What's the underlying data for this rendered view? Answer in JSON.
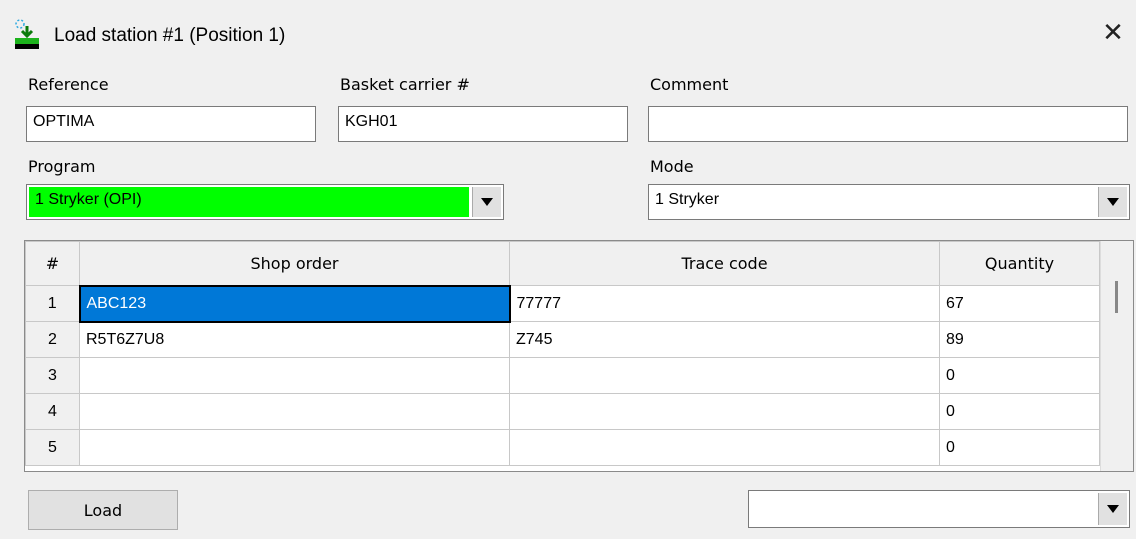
{
  "window": {
    "title": "Load station #1 (Position 1)"
  },
  "fields": {
    "reference": {
      "label": "Reference",
      "value": "OPTIMA"
    },
    "basket": {
      "label": "Basket carrier #",
      "value": "KGH01"
    },
    "comment": {
      "label": "Comment",
      "value": ""
    },
    "program": {
      "label": "Program",
      "value": "1 Stryker (OPI)",
      "color": "#00ff00"
    },
    "mode": {
      "label": "Mode",
      "value": "1 Stryker"
    }
  },
  "table": {
    "headers": [
      "#",
      "Shop order",
      "Trace code",
      "Quantity"
    ],
    "rows": [
      [
        "1",
        "ABC123",
        "77777",
        "67"
      ],
      [
        "2",
        "R5T6Z7U8",
        "Z745",
        "89"
      ],
      [
        "3",
        "",
        "",
        "0"
      ],
      [
        "4",
        "",
        "",
        "0"
      ],
      [
        "5",
        "",
        "",
        "0"
      ]
    ]
  },
  "footer": {
    "load_label": "Load",
    "combo_value": ""
  },
  "colors": {
    "selection": "#0078d7",
    "program_bg": "#00ff00"
  }
}
